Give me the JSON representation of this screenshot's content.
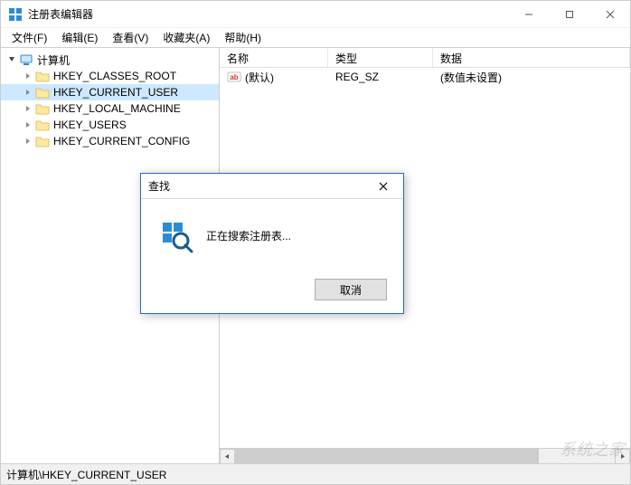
{
  "window": {
    "title": "注册表编辑器"
  },
  "menu": {
    "file": "文件(F)",
    "edit": "编辑(E)",
    "view": "查看(V)",
    "favorites": "收藏夹(A)",
    "help": "帮助(H)"
  },
  "tree": {
    "root": "计算机",
    "items": [
      "HKEY_CLASSES_ROOT",
      "HKEY_CURRENT_USER",
      "HKEY_LOCAL_MACHINE",
      "HKEY_USERS",
      "HKEY_CURRENT_CONFIG"
    ],
    "selected_index": 1
  },
  "list": {
    "columns": {
      "name": "名称",
      "type": "类型",
      "data": "数据"
    },
    "rows": [
      {
        "name": "(默认)",
        "type": "REG_SZ",
        "data": "(数值未设置)"
      }
    ]
  },
  "statusbar": {
    "path": "计算机\\HKEY_CURRENT_USER"
  },
  "dialog": {
    "title": "查找",
    "message": "正在搜索注册表...",
    "cancel": "取消"
  },
  "watermark": "系统之家"
}
